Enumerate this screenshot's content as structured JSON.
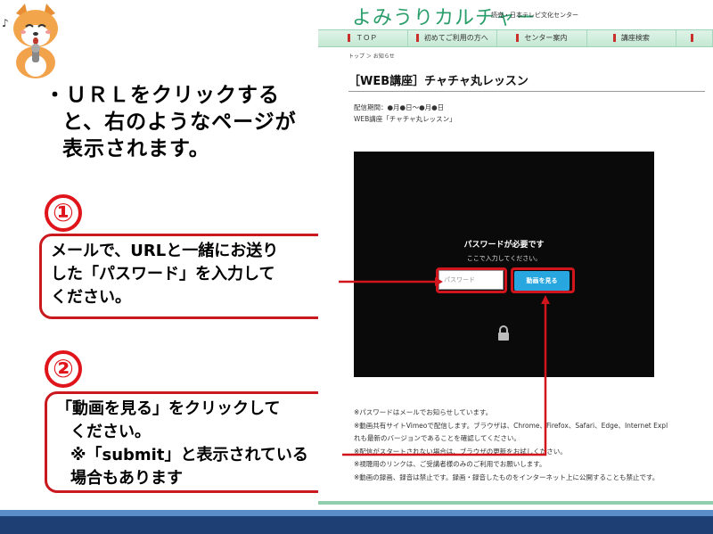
{
  "instruction": {
    "line1": "・ＵＲＬをクリックする",
    "line2": "と、右のようなページが",
    "line3": "表示されます。"
  },
  "step1": {
    "number": "①",
    "line1": "メールで、URLと一緒にお送り",
    "line2": "した「パスワード」を入力して",
    "line3": "ください。"
  },
  "step2": {
    "number": "②",
    "line1": "「動画を見る」をクリックして",
    "line2": "ください。",
    "line3": "※「submit」と表示されている",
    "line4": "場合もあります"
  },
  "site": {
    "logo": "よみうりカルチャー",
    "logo_sub": "読売・日本テレビ文化センター",
    "nav": [
      "ＴＯＰ",
      "初めてご利用の方へ",
      "センター案内",
      "講座検索",
      ""
    ],
    "breadcrumb": "トップ ＞ お知らせ",
    "page_title": "［WEB講座］チャチャ丸レッスン",
    "period": "配信期間：●月●日～●月●日",
    "course": "WEB講座「チャチャ丸レッスン」",
    "video": {
      "title": "パスワードが必要です",
      "subtitle": "ここで入力してください。",
      "input_placeholder": "パスワード",
      "button": "動画を見る"
    },
    "notes": [
      "※パスワードはメールでお知らせしています。",
      "※動画共有サイトVimeoで配信します。ブラウザは、Chrome、Firefox、Safari、Edge、Internet Expl",
      "れも最新のバージョンであることを確認してください。",
      "※配信がスタートされない場合は、ブラウザの更新をお試しください。",
      "※視聴用のリンクは、ご受講者様のみのご利用でお願いします。",
      "※動画の録画、録音は禁止です。録画・録音したものをインターネット上に公開することも禁止です。"
    ]
  },
  "colors": {
    "accent_red": "#d0161c",
    "site_green": "#2a9e6a",
    "button_blue": "#27a6e0",
    "footer_dark": "#1e3f73",
    "footer_light": "#5b8ec9"
  }
}
